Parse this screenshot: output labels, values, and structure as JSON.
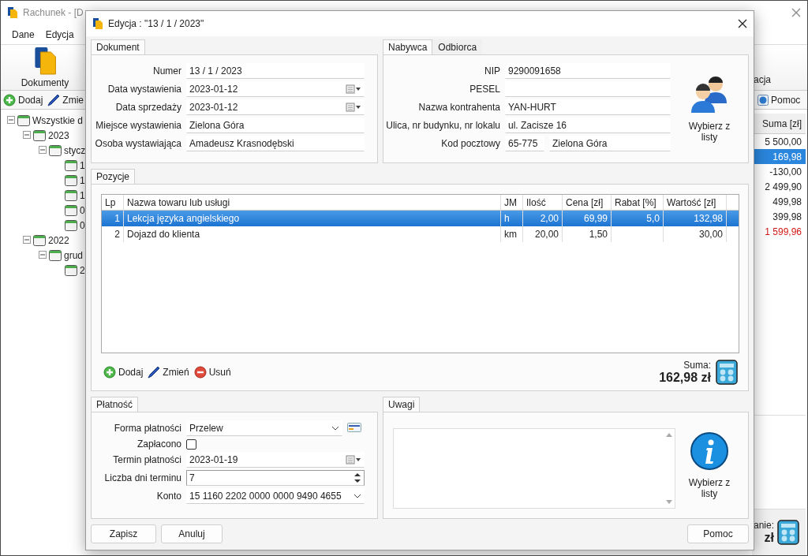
{
  "app": {
    "title": "Rachunek - [D",
    "menu": [
      "Dane",
      "Edycja"
    ],
    "toolbar": {
      "documents": "Dokumenty",
      "right_cut": "acja"
    },
    "actions": [
      "Dodaj",
      "Zmie"
    ],
    "help": "Pomoc",
    "tree": [
      {
        "label": "Wszystkie d",
        "expanded": true,
        "children": [
          {
            "label": "2023",
            "expanded": true,
            "children": [
              {
                "label": "stycz",
                "expanded": true,
                "children": [
                  {
                    "label": "1"
                  },
                  {
                    "label": "1"
                  },
                  {
                    "label": "1"
                  },
                  {
                    "label": "0"
                  },
                  {
                    "label": "0"
                  }
                ]
              }
            ]
          },
          {
            "label": "2022",
            "expanded": true,
            "children": [
              {
                "label": "grud",
                "expanded": true,
                "children": [
                  {
                    "label": "2"
                  }
                ]
              }
            ]
          }
        ]
      }
    ],
    "sums": {
      "header": "Suma [zł]",
      "rows": [
        {
          "value": "5 500,00",
          "selected": false,
          "color": "#222222"
        },
        {
          "value": "169,98",
          "selected": true
        },
        {
          "value": "-130,00",
          "selected": false,
          "color": "#222222"
        },
        {
          "value": "2 499,90",
          "selected": false,
          "color": "#222222"
        },
        {
          "value": "499,98",
          "selected": false,
          "color": "#222222"
        },
        {
          "value": "399,98",
          "selected": false,
          "color": "#222222"
        },
        {
          "value": "1 599,96",
          "selected": false,
          "color": "#d01818"
        }
      ]
    },
    "total_label": "anie:",
    "total_value": "zł"
  },
  "dialog": {
    "title": "Edycja : \"13 / 1 / 2023\"",
    "document": {
      "tab": "Dokument",
      "fields": [
        {
          "label": "Numer",
          "value": "13 / 1 / 2023",
          "kind": "text"
        },
        {
          "label": "Data wystawienia",
          "value": "2023-01-12",
          "kind": "date"
        },
        {
          "label": "Data sprzedaży",
          "value": "2023-01-12",
          "kind": "date"
        },
        {
          "label": "Miejsce wystawienia",
          "value": "Zielona Góra",
          "kind": "text"
        },
        {
          "label": "Osoba wystawiająca",
          "value": "Amadeusz Krasnodębski",
          "kind": "text"
        }
      ]
    },
    "buyer": {
      "tabs": [
        {
          "label": "Nabywca",
          "selected": true
        },
        {
          "label": "Odbiorca",
          "selected": false
        }
      ],
      "fields": [
        {
          "label": "NIP",
          "value": "9290091658"
        },
        {
          "label": "PESEL"
        },
        {
          "label": "Nazwa kontrahenta",
          "value": "YAN-HURT"
        },
        {
          "label": "Ulica, nr budynku, nr lokalu",
          "value": "ul. Zacisze 16"
        },
        {
          "label": "Kod pocztowy",
          "value": "65-775",
          "value_2": "Zielona Góra"
        }
      ],
      "pick_button": "Wybierz z listy"
    },
    "items": {
      "tab": "Pozycje",
      "columns": [
        "Lp",
        "Nazwa towaru lub usługi",
        "JM",
        "Ilość",
        "Cena [zł]",
        "Rabat [%]",
        "Wartość [zł]"
      ],
      "rows": [
        {
          "selected": true,
          "lp": "1",
          "name": "Lekcja języka angielskiego",
          "unit": "h",
          "qty": "2,00",
          "price": "69,99",
          "discount": "5,0",
          "value": "132,98"
        },
        {
          "selected": false,
          "lp": "2",
          "name": "Dojazd do klienta",
          "unit": "km",
          "qty": "20,00",
          "price": "1,50",
          "value": "30,00"
        }
      ],
      "actions": [
        {
          "label": "Dodaj",
          "kind": "add"
        },
        {
          "label": "Zmień",
          "kind": "edit"
        },
        {
          "label": "Usuń",
          "kind": "remove"
        }
      ],
      "sum_label": "Suma:",
      "sum_value": "162,98 zł"
    },
    "payment": {
      "tab": "Płatność",
      "fields": [
        {
          "label": "Forma płatności",
          "kind": "select",
          "value": "Przelew"
        },
        {
          "label": "Zapłacono",
          "kind": "checkbox",
          "checked": false
        },
        {
          "label": "Termin płatności",
          "kind": "date",
          "value": "2023-01-19"
        },
        {
          "label": "Liczba dni terminu",
          "kind": "spin",
          "value": "7"
        },
        {
          "label": "Konto",
          "kind": "select",
          "value": "15 1160 2202 0000 0000 9490 4655"
        }
      ]
    },
    "notes": {
      "tab": "Uwagi",
      "pick_button": "Wybierz z listy"
    },
    "footer": {
      "save": "Zapisz",
      "cancel": "Anuluj",
      "help": "Pomoc"
    }
  }
}
